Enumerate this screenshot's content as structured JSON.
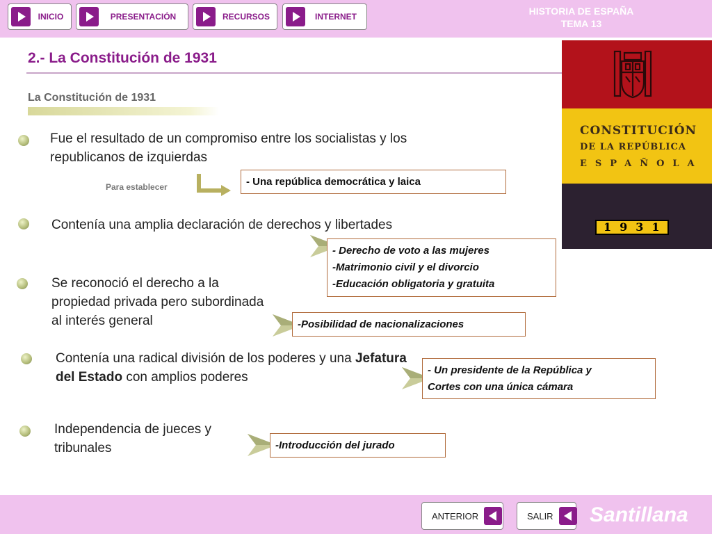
{
  "nav": [
    {
      "label": "INICIO"
    },
    {
      "label": "PRESENTACIÓN"
    },
    {
      "label": "RECURSOS"
    },
    {
      "label": "INTERNET"
    }
  ],
  "course": {
    "line1": "HISTORIA DE ESPAÑA",
    "line2": "TEMA 13"
  },
  "page_title": "2.- La Constitución de 1931",
  "subtitle": "La Constitución de 1931",
  "cover": {
    "line1": "CONSTITUCIÓN",
    "line2": "DE LA REPÚBLICA",
    "line3": "ESPAÑOLA",
    "year": "1931"
  },
  "points": [
    {
      "text": "Fue el resultado de un compromiso entre los socialistas y los republicanos de izquierdas",
      "label": "Para establecer",
      "box": [
        "- Una república democrática y laica"
      ]
    },
    {
      "text": "Contenía una amplia declaración de derechos y libertades",
      "box": [
        "- Derecho de voto a las mujeres",
        "-Matrimonio civil y el divorcio",
        "-Educación obligatoria y gratuita"
      ]
    },
    {
      "text": "Se reconoció el derecho a la propiedad privada pero subordinada al interés general",
      "box": [
        "-Posibilidad de nacionalizaciones"
      ]
    },
    {
      "text_a": "Contenía una radical división de los poderes y una ",
      "text_bold": "Jefatura del Estado",
      "text_b": " con amplios poderes",
      "box": [
        "- Un presidente de la República y",
        "Cortes con una única cámara"
      ]
    },
    {
      "text": "Independencia de jueces y tribunales",
      "box": [
        "-Introducción del jurado"
      ]
    }
  ],
  "footer": {
    "prev_label": "ANTERIOR",
    "exit_label": "SALIR",
    "brand": "Santillana"
  }
}
